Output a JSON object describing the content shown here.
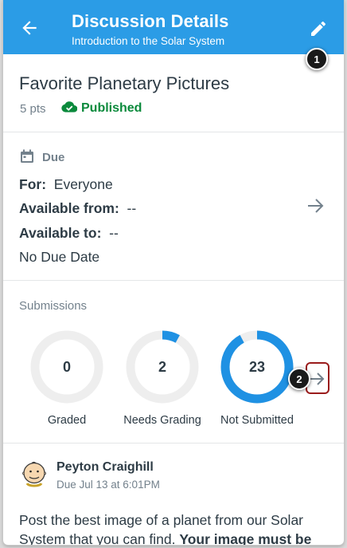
{
  "header": {
    "title": "Discussion Details",
    "subtitle": "Introduction to the Solar System",
    "back_icon": "arrow-left-icon",
    "edit_icon": "pencil-icon",
    "bg_color": "#2b9ce6"
  },
  "callouts": {
    "one": "1",
    "two": "2"
  },
  "discussion": {
    "title": "Favorite Planetary Pictures",
    "points": "5 pts",
    "status": "Published",
    "status_color": "#0b8a3c"
  },
  "due": {
    "heading": "Due",
    "for_label": "For:",
    "for_value": "Everyone",
    "available_from_label": "Available from:",
    "available_from_value": "--",
    "available_to_label": "Available to:",
    "available_to_value": "--",
    "no_due_date": "No Due Date"
  },
  "submissions": {
    "heading": "Submissions",
    "items": [
      {
        "value": "0",
        "label": "Graded",
        "fraction": 0.0
      },
      {
        "value": "2",
        "label": "Needs Grading",
        "fraction": 0.08
      },
      {
        "value": "23",
        "label": "Not Submitted",
        "fraction": 0.92
      }
    ],
    "ring_color": "#1f91e3",
    "track_color": "#eeeeee"
  },
  "post": {
    "author": "Peyton Craighill",
    "due": "Due Jul 13 at 6:01PM",
    "body_start": "Post the best image of a planet from our Solar System that you can find. ",
    "body_bold": "Your image must be"
  }
}
